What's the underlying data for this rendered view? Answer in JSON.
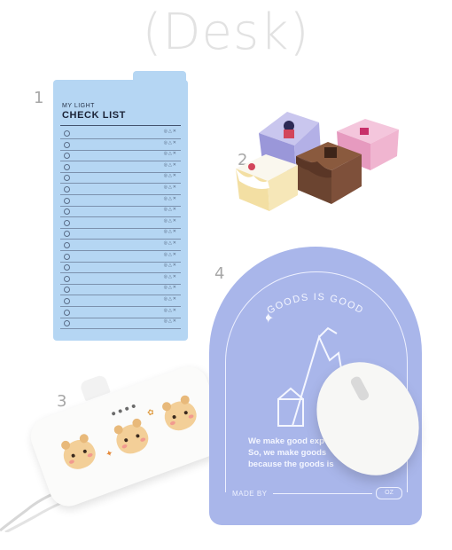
{
  "title": "(Desk)",
  "labels": {
    "item1": "1",
    "item2": "2",
    "item3": "3",
    "item4": "4"
  },
  "checklist": {
    "subtitle": "MY LIGHT",
    "heading": "CHECK LIST",
    "row_marks": "◎△✕",
    "rows": 18
  },
  "mousepad": {
    "arc_text": "GOODS IS GOOD",
    "lines": [
      "We make good exp",
      "So, we make goods",
      "because the goods is"
    ],
    "made_by": "MADE BY",
    "oz": "OZ"
  },
  "colors": {
    "pad_blue": "#b5d6f3",
    "mousepad_lavender": "#a9b6ea",
    "bear": "#f3cf98"
  }
}
